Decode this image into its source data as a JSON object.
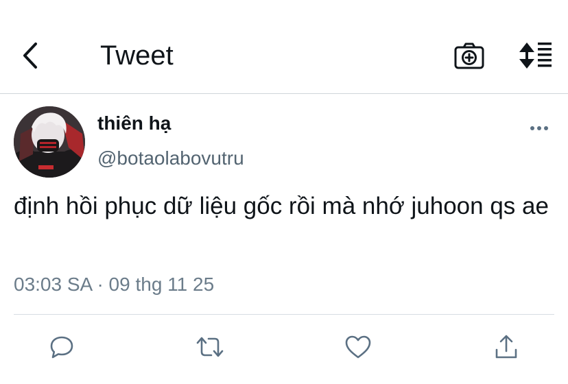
{
  "header": {
    "title": "Tweet"
  },
  "tweet": {
    "display_name": "thiên hạ",
    "handle": "@botaolabovutru",
    "text": "định hồi phục dữ liệu gốc rồi mà nhớ juhoon qs ae",
    "timestamp": "03:03 SA",
    "separator": "·",
    "date": "09 thg 11 25"
  },
  "actions": [
    "reply",
    "retweet",
    "like",
    "share"
  ],
  "colors": {
    "text": "#0f1419",
    "secondary": "#536471",
    "divider": "#d6dde2",
    "action_icon": "#5b7083"
  }
}
